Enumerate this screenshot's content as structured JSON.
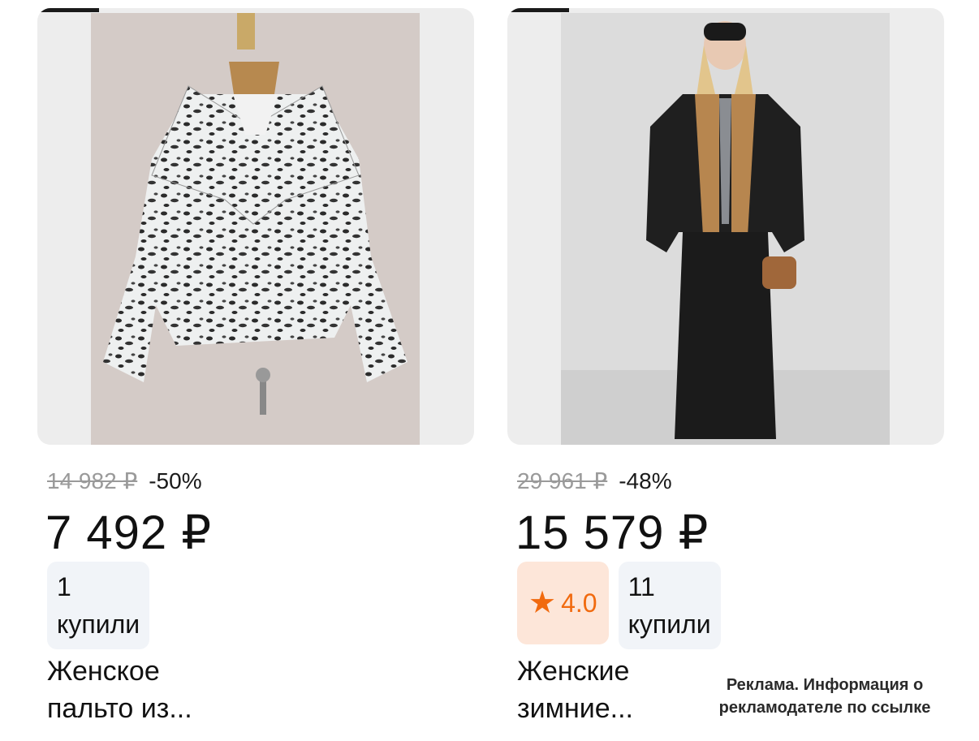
{
  "products": [
    {
      "old_price": "14 982 ₽",
      "discount": "-50%",
      "price": "7 492 ₽",
      "purchases": "1\nкупили",
      "purchases_count": "1",
      "purchases_label": "купили",
      "title_line1": "Женское",
      "title_line2": "пальто из..."
    },
    {
      "old_price": "29 961 ₽",
      "discount": "-48%",
      "price": "15 579 ₽",
      "rating": "4.0",
      "purchases_count": "11",
      "purchases_label": "купили",
      "title_line1": "Женские",
      "title_line2": "зимние..."
    }
  ],
  "ad_note": {
    "line1": "Реклама. Информация о",
    "line2": "рекламодателе по ссылке"
  },
  "colors": {
    "rating_accent": "#f16a0f",
    "rating_bg": "#fde6d9",
    "badge_bg": "#f1f4f8",
    "old_price": "#9a9a9a"
  },
  "icons": [
    "star-icon"
  ]
}
